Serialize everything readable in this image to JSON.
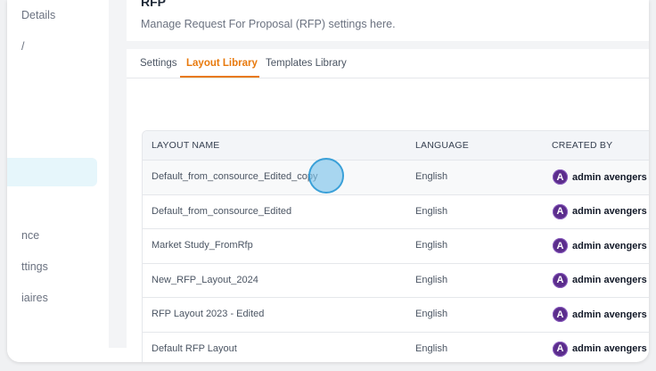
{
  "sidebar": {
    "items": [
      {
        "label": "Details"
      },
      {
        "label": "/"
      },
      {
        "label": "nce"
      },
      {
        "label": "ttings"
      },
      {
        "label": "iaires"
      }
    ]
  },
  "header": {
    "title": "RFP",
    "subtitle": "Manage Request For Proposal (RFP) settings here."
  },
  "tabs": [
    {
      "label": "Settings"
    },
    {
      "label": "Layout Library"
    },
    {
      "label": "Templates Library"
    }
  ],
  "table": {
    "headers": [
      "LAYOUT NAME",
      "LANGUAGE",
      "CREATED BY"
    ],
    "rows": [
      {
        "name": "Default_from_consource_Edited_copy",
        "language": "English",
        "created_by": "admin avengers"
      },
      {
        "name": "Default_from_consource_Edited",
        "language": "English",
        "created_by": "admin avengers"
      },
      {
        "name": "Market Study_FromRfp",
        "language": "English",
        "created_by": "admin avengers"
      },
      {
        "name": "New_RFP_Layout_2024",
        "language": "English",
        "created_by": "admin avengers"
      },
      {
        "name": "RFP Layout 2023 - Edited",
        "language": "English",
        "created_by": "admin avengers"
      },
      {
        "name": "Default RFP Layout",
        "language": "English",
        "created_by": "admin avengers"
      }
    ],
    "avatar_letter": "A"
  },
  "colors": {
    "accent": "#e8790c",
    "avatar": "#5b2d8c",
    "active_sidebar_bg": "#e6f6fb"
  }
}
